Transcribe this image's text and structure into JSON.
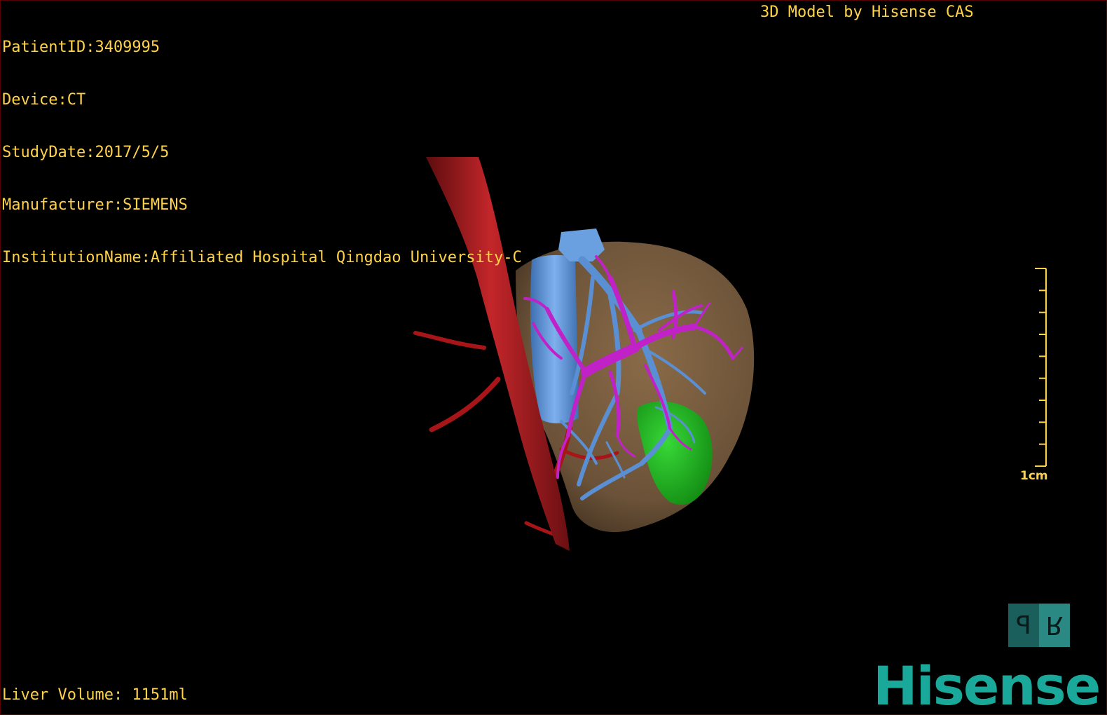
{
  "overlay": {
    "patient_id": "PatientID:3409995",
    "device": "Device:CT",
    "study_date": "StudyDate:2017/5/5",
    "manufacturer": "Manufacturer:SIEMENS",
    "institution": "InstitutionName:Affiliated Hospital Qingdao University-C",
    "model_credit": "3D Model by Hisense CAS",
    "liver_volume": "Liver Volume: 1151ml"
  },
  "scale": {
    "label": "1cm",
    "tick_count": 10
  },
  "orientation_cube": {
    "left_face": "P",
    "right_face": "R",
    "colors": {
      "left": "#1a5f5b",
      "right": "#2a8a83"
    }
  },
  "brand": {
    "logo_text": "Hisense",
    "color": "#1aa89a"
  },
  "colors": {
    "overlay_text": "#ffd24a",
    "liver": "#6b5238",
    "artery": "#a81518",
    "portal_vein": "#5b8fd4",
    "hepatic_vein": "#c022c8",
    "gallbladder": "#22b022"
  }
}
